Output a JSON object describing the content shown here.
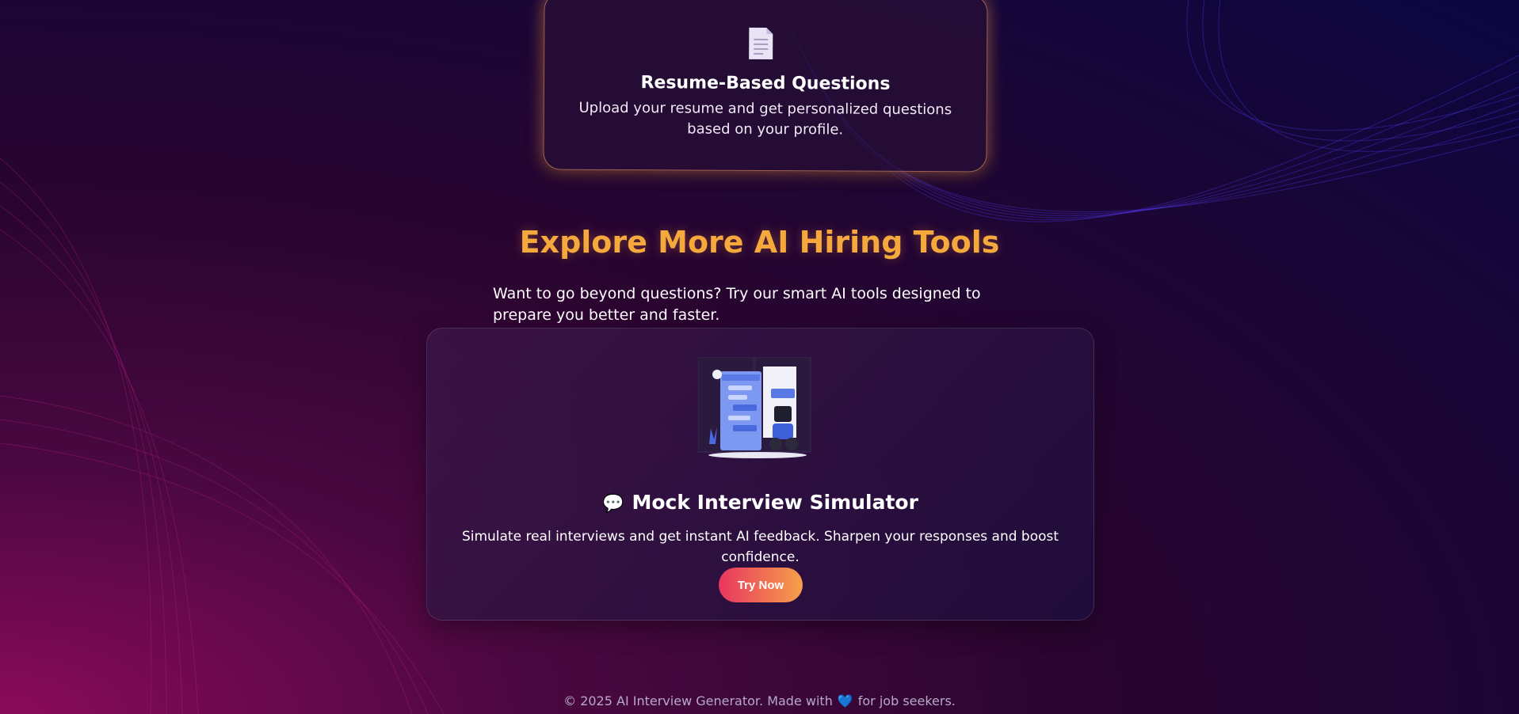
{
  "feature_card": {
    "icon": "document-icon",
    "title": "Resume-Based Questions",
    "description": "Upload your resume and get personalized questions based on your profile."
  },
  "explore": {
    "title": "Explore More AI Hiring Tools",
    "description": "Want to go beyond questions? Try our smart AI tools designed to prepare you better and faster."
  },
  "tool_card": {
    "illustration": "chatbot-illustration",
    "icon": "chat-bubble-icon",
    "title": "Mock Interview Simulator",
    "description": "Simulate real interviews and get instant AI feedback. Sharpen your responses and boost confidence.",
    "button_label": "Try Now"
  },
  "footer": {
    "prefix": "© 2025 AI Interview Generator. Made with",
    "suffix": "for job seekers.",
    "heart_icon": "heart-icon"
  },
  "colors": {
    "accent_orange": "#f5a93c",
    "button_gradient_start": "#e8365f",
    "button_gradient_end": "#f6a04a",
    "heart_blue": "#3d6fe8"
  }
}
